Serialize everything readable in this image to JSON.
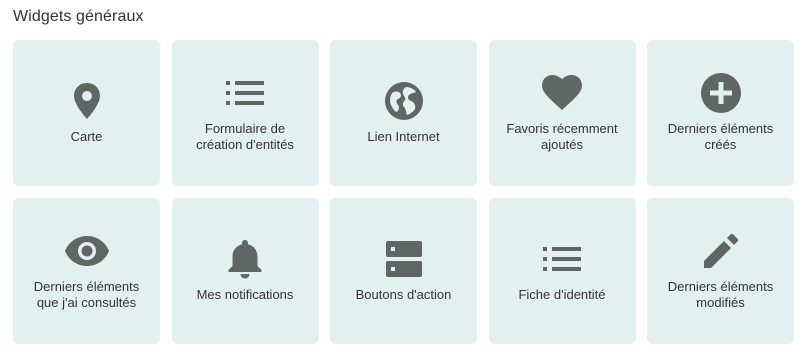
{
  "section": {
    "title": "Widgets généraux"
  },
  "colors": {
    "tile_background": "#e2f1f0",
    "icon": "#5f6664",
    "text": "#333333"
  },
  "widgets": [
    {
      "label": "Carte",
      "icon": "map-pin-icon"
    },
    {
      "label": "Formulaire de\ncréation d'entités",
      "icon": "list-icon"
    },
    {
      "label": "Lien Internet",
      "icon": "globe-icon"
    },
    {
      "label": "Favoris récemment\najoutés",
      "icon": "heart-icon"
    },
    {
      "label": "Derniers éléments\ncréés",
      "icon": "plus-circle-icon"
    },
    {
      "label": "Derniers éléments\nque j'ai consultés",
      "icon": "eye-icon"
    },
    {
      "label": "Mes notifications",
      "icon": "bell-icon"
    },
    {
      "label": "Boutons d'action",
      "icon": "server-icon"
    },
    {
      "label": "Fiche d'identité",
      "icon": "list-icon"
    },
    {
      "label": "Derniers éléments\nmodifiés",
      "icon": "pencil-icon"
    }
  ]
}
